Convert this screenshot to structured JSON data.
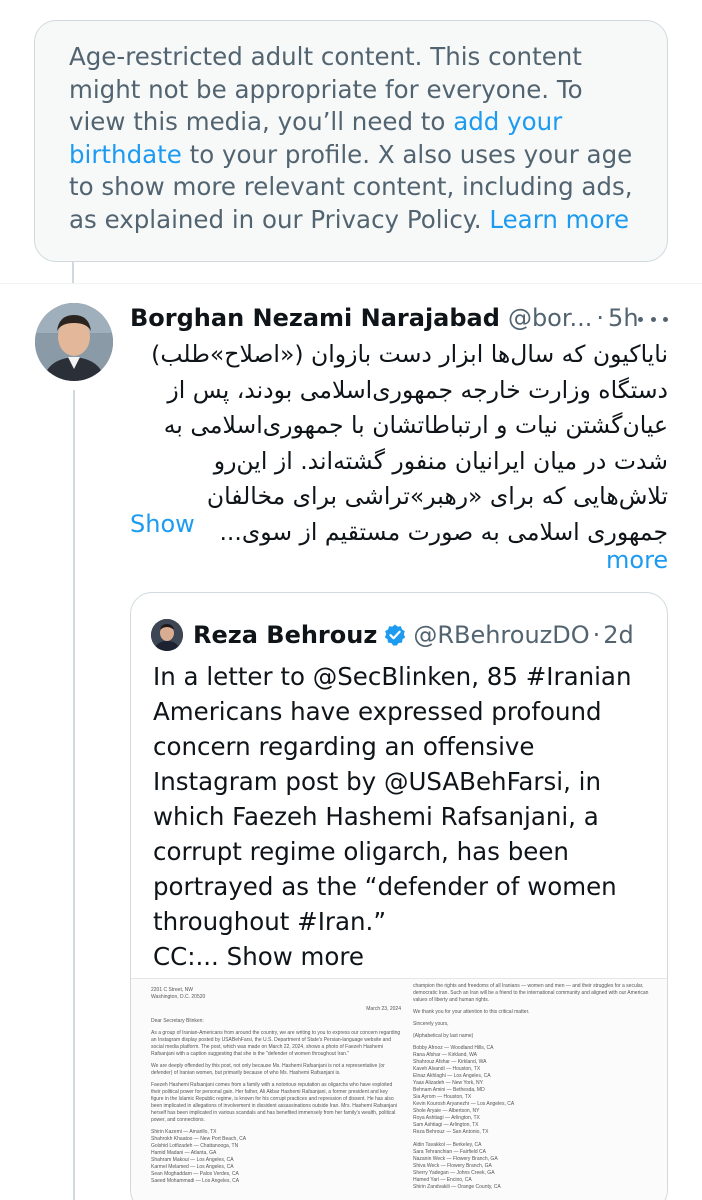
{
  "age_notice": {
    "text_before": "Age-restricted adult content. This content might not be appropriate for everyone. To view this media, you’ll need to ",
    "link_birthdate": "add your birthdate",
    "text_middle": " to your profile. X also uses your age to show more relevant content, including ads, as explained in our Privacy Policy. ",
    "link_learn": "Learn more"
  },
  "post": {
    "author_name": "Borghan Nezami Narajabad",
    "handle": "@bor...",
    "separator": "·",
    "time": "5h",
    "more_icon": "more-horizontal-icon",
    "body_lines": [
      "نایاکیون که سال‌ها ابزار دست بازوان («اصلاح»طلب)",
      "دستگاه وزارت خارجه جمهوری‌اسلامی بودند، پس از",
      "عیان‌گشتن نیات و  ارتباطاتشان با جمهوری‌اسلامی به",
      "شدت در میان ایرانیان منفور گشته‌اند. از این‌رو",
      "تلاش‌هایی که برای «رهبر»تراشی برای مخالفان",
      "جمهوری اسلامی به صورت مستقیم از سوی..."
    ],
    "show_more_part1": "Show",
    "show_more_part2": "more"
  },
  "quote": {
    "author_name": "Reza Behrouz",
    "verified_icon": "verified-badge-icon",
    "handle": "@RBehrouzDO",
    "separator": "·",
    "time": "2d",
    "body_lines": [
      "In a letter to @SecBlinken, 85 #Iranian",
      "Americans have expressed profound",
      "concern regarding an offensive",
      "Instagram post by @USABehFarsi, in",
      "which Faezeh Hashemi Rafsanjani, a",
      "corrupt regime oligarch, has been",
      "portrayed as the “defender of women",
      "throughout #Iran.”"
    ],
    "cc_text": "CC:...",
    "show_more": "Show more",
    "letter": {
      "address": [
        "2201 C Street, NW",
        "Washington, D.C. 20520"
      ],
      "date": "March 23, 2024",
      "salutation": "Dear Secretary Blinken:",
      "para1": "As a group of Iranian-Americans from around the country, we are writing to you to express our concern regarding an Instagram display posted by USABehFarsi, the U.S. Department of State's Persian-language website and social media platform. The post, which was made on March 22, 2024, shows a photo of Faezeh Hashemi Rafsanjani with a caption suggesting that she is the \"defender of women throughout Iran.\"",
      "para2": "We are deeply offended by this post, not only because Ms. Hashemi Rafsanjani is not a representative (or defender) of Iranian women, but primarily because of who Ms. Hashemi Rafsanjani is.",
      "para3": "Faezeh Hashemi Rafsanjani comes from a family with a notorious reputation as oligarchs who have exploited their political power for personal gain. Her father, Ali Akbar Hashemi Rafsanjani, a former president and key figure in the Islamic Republic regime, is known for his corrupt practices and repression of dissent. He has also been implicated in allegations of involvement in dissident assassinations outside Iran. Mrs. Hashemi Rafsanjani herself has been implicated in various scandals and has benefited immensely from her family's wealth, political power, and connections.",
      "names_left": [
        "Shirin Kazemi — Amarillo, TX",
        "Shahrokh Khaatoo — New Port Beach, CA",
        "Golshid Lotfizadeh — Chattanooga, TN",
        "Hamid Madani — Atlanta, GA",
        "Shahram Makoui — Los Angeles, CA",
        "Karmel Melamed — Los Angeles, CA",
        "Sean Moghaddam — Palos Verdes, CA",
        "Saeed Mohammadi — Los Angeles, CA"
      ],
      "right_para1": "champion the rights and freedoms of all Iranians — women and men — and their struggles for a secular, democratic Iran. Such an Iran will be a friend to the international community and aligned with our American values of liberty and human rights.",
      "right_para2": "We thank you for your attention to this critical matter.",
      "closing": "Sincerely yours,",
      "alpha_note": "(Alphabetical by last name)",
      "names_right_1": [
        "Bobby Afrooz — Woodland Hills, CA",
        "Rana Afshar — Kirkland, WA",
        "Shahrouz Afshar — Kirkland, WA",
        "Kaveh Alvandi — Houston, TX",
        "Elnaz Akhlaghi — Los Angeles, CA",
        "Yaas Alizadeh — New York, NY",
        "Behnam Amini — Bethesda, MD",
        "Sia Ayrom — Houston, TX",
        "Kevin Kourosh Aryanezhr — Los Angeles, CA",
        "Shole Aryaie — Albertson, NY",
        "Roya Ashtiagi — Arlington, TX",
        "Sam Ashtiagi — Arlington, TX",
        "Reza Behrouz — San Antonio, TX"
      ],
      "names_right_2": [
        "Aldin Tavakkol — Berkeley, CA",
        "Sara Tehranchian — Fairfield CA",
        "Nazanin Weck — Flowery Branch, GA",
        "Shiva Weck — Flowery Branch, GA",
        "Sherry Yadegan — Johns Creek, GA",
        "Hamed Yari — Encino, CA",
        "Shirin Zandvakili — Orange County, CA"
      ]
    }
  },
  "colors": {
    "link_blue": "#1d9bf0",
    "muted_gray": "#536471",
    "text_dark": "#0f1419",
    "border": "#cfd9de",
    "notice_bg": "#f7f9f9"
  }
}
